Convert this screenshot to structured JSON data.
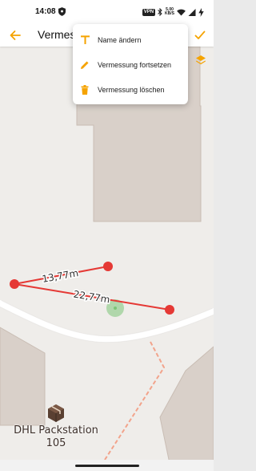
{
  "status_bar": {
    "time": "14:08",
    "vpn_label": "VPN",
    "speed_value": "5,00",
    "speed_unit": "KB/S",
    "icons": [
      "shield-icon",
      "vpn-icon",
      "bluetooth-icon",
      "network-speed-icon",
      "wifi-icon",
      "signal-icon",
      "battery-charging-icon"
    ]
  },
  "app_bar": {
    "title": "Vermessung",
    "back_icon": "arrow-left-icon",
    "confirm_icon": "check-icon",
    "accent_color": "#f5a300"
  },
  "menu": {
    "items": [
      {
        "label": "Name ändern",
        "icon": "text-icon"
      },
      {
        "label": "Vermessung fortsetzen",
        "icon": "pencil-icon"
      },
      {
        "label": "Vermessung löschen",
        "icon": "trash-icon"
      }
    ]
  },
  "map": {
    "layers_icon": "layers-icon",
    "measurement_color": "#e53935",
    "location_color": "#7cc576",
    "segments": [
      {
        "label": "13,77m"
      },
      {
        "label": "22,77m"
      }
    ],
    "poi": {
      "name_line1": "DHL Packstation",
      "name_line2": "105",
      "icon": "parcel-locker-icon"
    }
  }
}
